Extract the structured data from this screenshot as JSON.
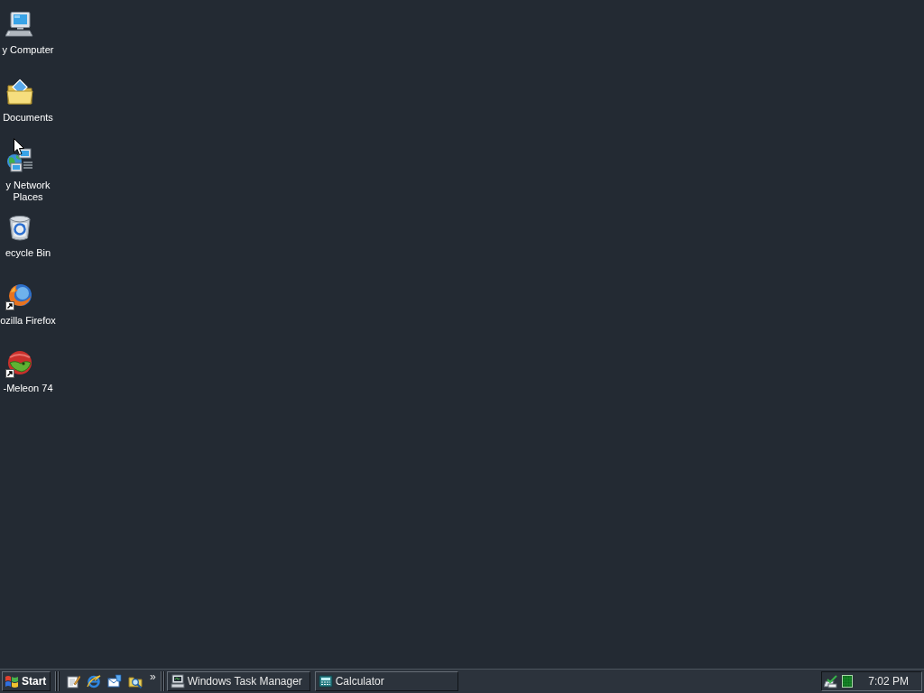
{
  "desktop": {
    "icons": [
      {
        "label": "y Computer",
        "shortcut": false
      },
      {
        "label": "Documents",
        "shortcut": false
      },
      {
        "label": "y Network Places",
        "shortcut": false
      },
      {
        "label": "ecycle Bin",
        "shortcut": false
      },
      {
        "label": "ozilla Firefox",
        "shortcut": true
      },
      {
        "label": "-Meleon 74",
        "shortcut": true
      }
    ]
  },
  "taskbar": {
    "start_button": {
      "label": "Start"
    },
    "quick_launch": {
      "more": "»"
    },
    "tasks": [
      {
        "label": "Windows Task Manager",
        "selected": false
      },
      {
        "label": "Calculator",
        "selected": false
      }
    ],
    "clock": "7:02 PM"
  }
}
